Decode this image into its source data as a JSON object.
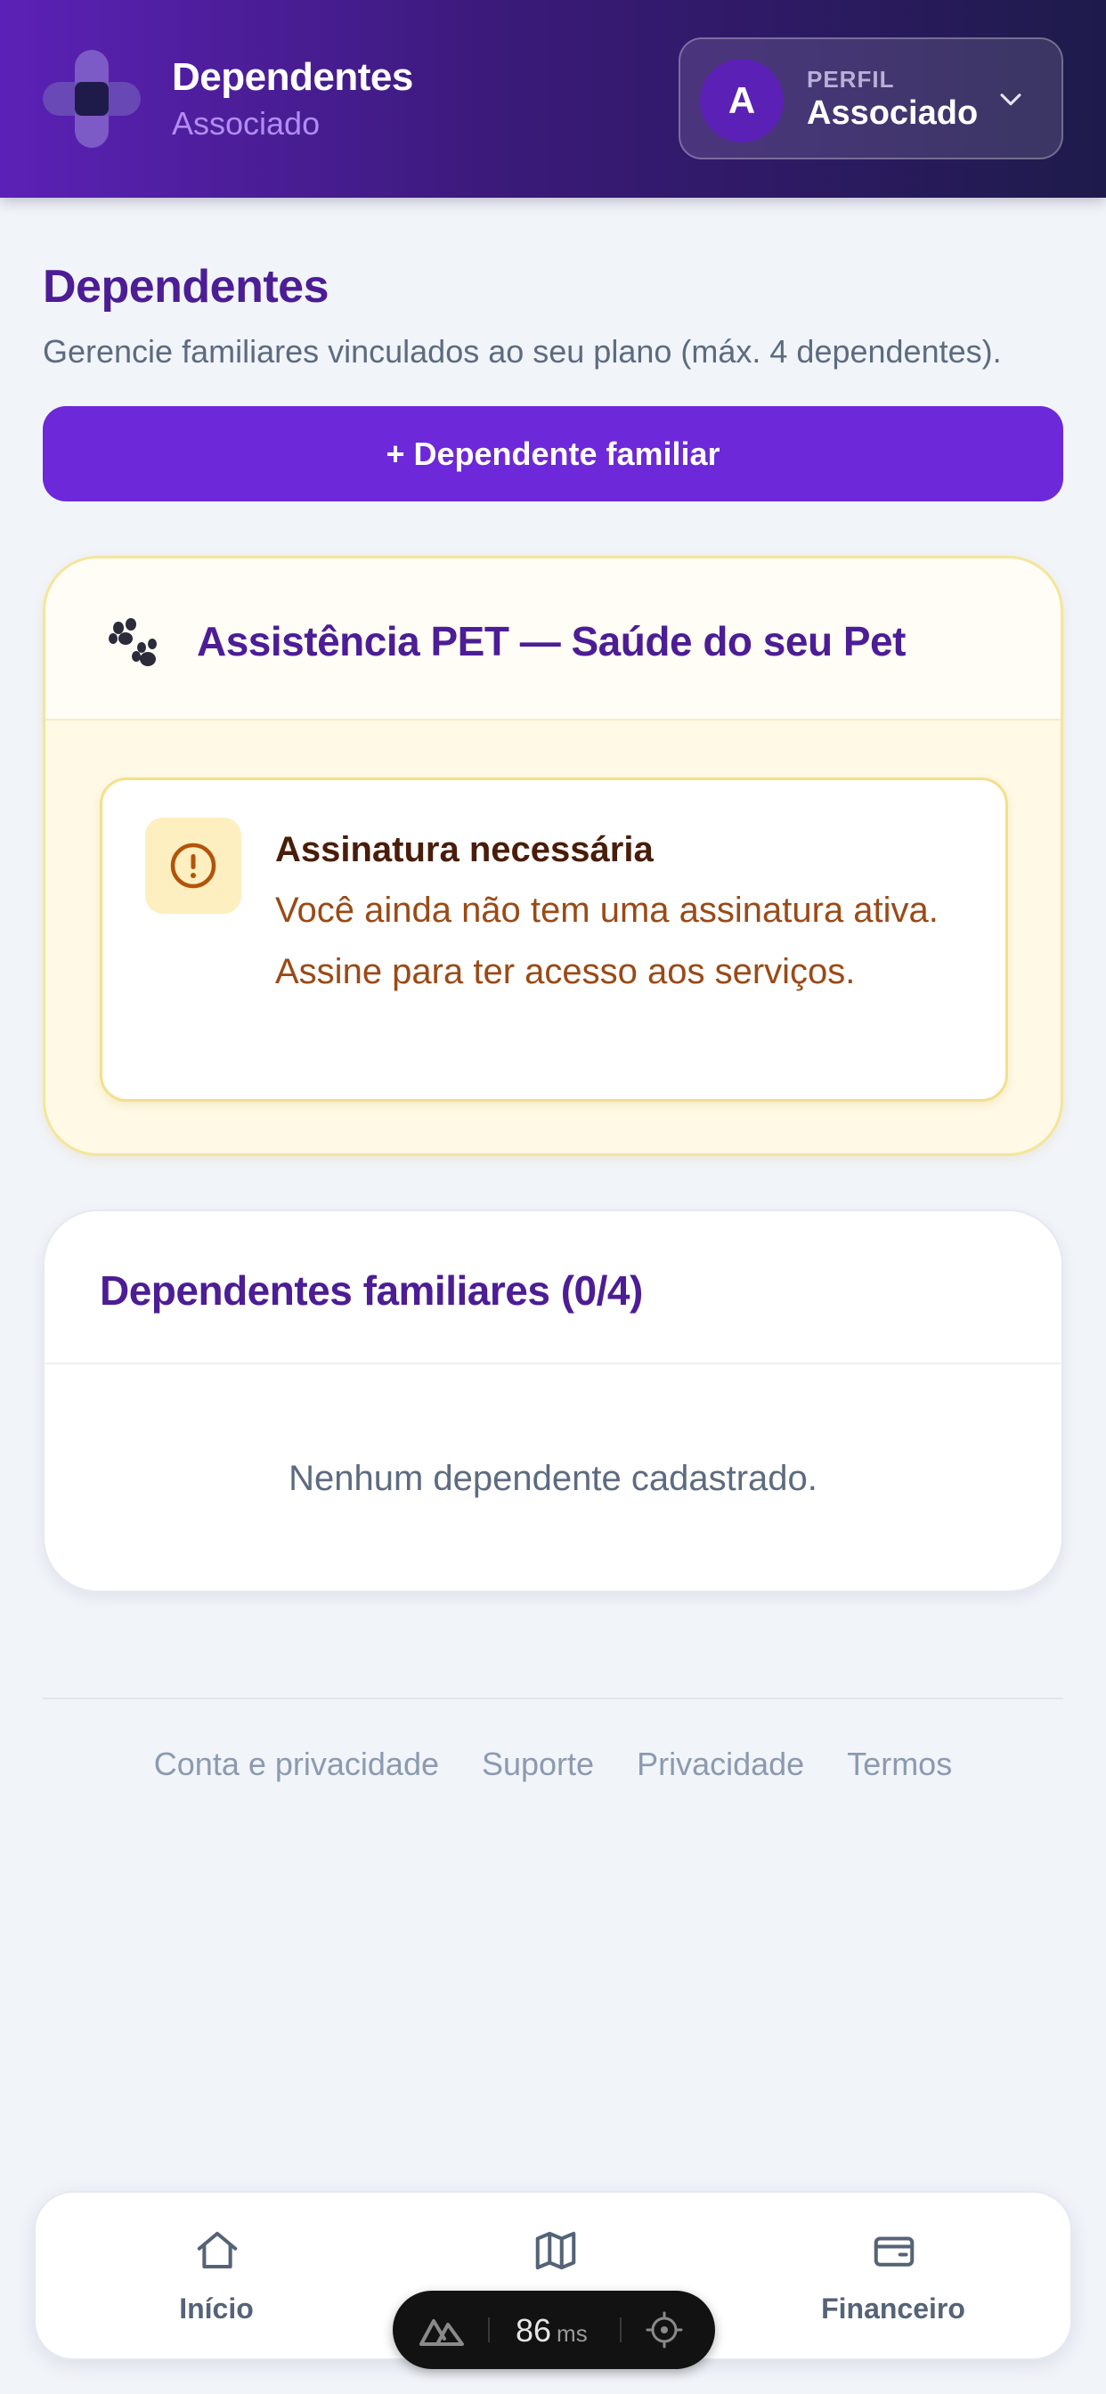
{
  "header": {
    "title": "Dependentes",
    "subtitle": "Associado",
    "profile": {
      "avatar_letter": "A",
      "label": "PERFIL",
      "value": "Associado"
    }
  },
  "page": {
    "title": "Dependentes",
    "description": "Gerencie familiares vinculados ao seu plano (máx. 4 dependentes).",
    "add_button": "+ Dependente familiar"
  },
  "pet_card": {
    "title": "Assistência PET — Saúde do seu Pet",
    "alert": {
      "title": "Assinatura necessária",
      "text": "Você ainda não tem uma assinatura ativa. Assine para ter acesso aos serviços."
    }
  },
  "dependents_card": {
    "title": "Dependentes familiares (0/4)",
    "empty_text": "Nenhum dependente cadastrado."
  },
  "footer": {
    "links": [
      "Conta e privacidade",
      "Suporte",
      "Privacidade",
      "Termos"
    ]
  },
  "bottom_nav": {
    "items": [
      {
        "label": "Início",
        "icon": "home-icon"
      },
      {
        "label": "",
        "icon": "map-icon"
      },
      {
        "label": "Financeiro",
        "icon": "wallet-icon"
      }
    ]
  },
  "dev_toolbar": {
    "value": "86",
    "unit": "ms"
  },
  "colors": {
    "primary": "#6d28d9",
    "heading": "#4c1d95",
    "alert_text": "#9a4a17",
    "alert_title": "#4a1d0a",
    "muted": "#5c6b80"
  }
}
